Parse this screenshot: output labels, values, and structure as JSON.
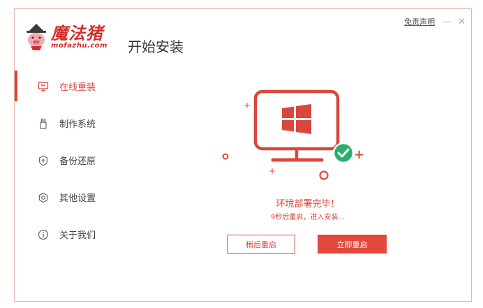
{
  "header": {
    "brand_cn": "魔法猪",
    "brand_en": "mofazhu.com",
    "title": "开始安装",
    "disclaimer": "免责声明",
    "minimize_glyph": "—",
    "close_glyph": "✕"
  },
  "sidebar": {
    "items": [
      {
        "label": "在线重装",
        "icon": "monitor-icon",
        "active": true
      },
      {
        "label": "制作系统",
        "icon": "usb-icon",
        "active": false
      },
      {
        "label": "备份还原",
        "icon": "backup-icon",
        "active": false
      },
      {
        "label": "其他设置",
        "icon": "gear-icon",
        "active": false
      },
      {
        "label": "关于我们",
        "icon": "info-icon",
        "active": false
      }
    ]
  },
  "main": {
    "status_title": "环境部署完毕！",
    "status_sub": "9秒后重启，进入安装...",
    "later_button": "稍后重启",
    "now_button": "立即重启"
  },
  "colors": {
    "accent": "#d9473d",
    "success": "#2ab06f",
    "border": "#e8b2ad"
  }
}
